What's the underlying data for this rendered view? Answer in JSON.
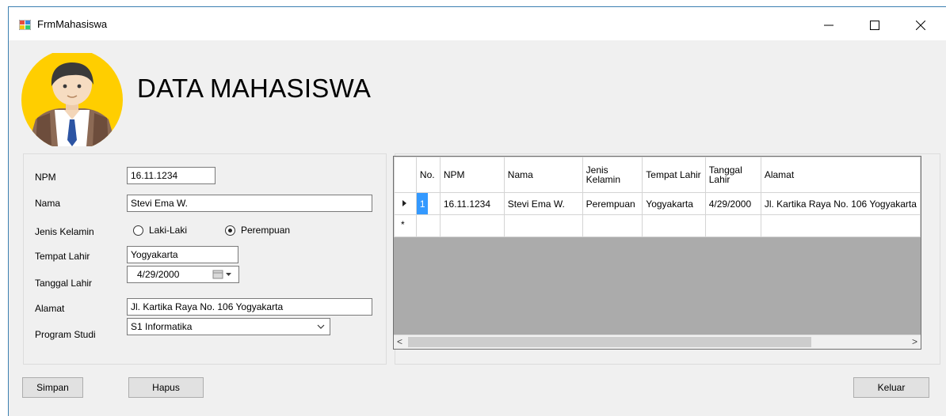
{
  "window": {
    "title": "FrmMahasiswa",
    "icon": "form-app-icon",
    "controls": {
      "minimize": "—",
      "maximize": "☐",
      "close": "✕"
    }
  },
  "header": {
    "title": "DATA MAHASISWA",
    "avatar_icon": "student-avatar-icon"
  },
  "form": {
    "npm": {
      "label": "NPM",
      "value": "16.11.1234"
    },
    "nama": {
      "label": "Nama",
      "value": "Stevi Ema W."
    },
    "jenis_kelamin": {
      "label": "Jenis Kelamin",
      "options": [
        "Laki-Laki",
        "Perempuan"
      ],
      "selected": "Perempuan"
    },
    "tempat_lahir": {
      "label": "Tempat Lahir",
      "value": "Yogyakarta"
    },
    "tanggal_lahir": {
      "label": "Tanggal Lahir",
      "value": "4/29/2000"
    },
    "alamat": {
      "label": "Alamat",
      "value": "Jl. Kartika Raya No. 106 Yogyakarta"
    },
    "program_studi": {
      "label": "Program Studi",
      "value": "S1 Informatika"
    }
  },
  "grid": {
    "columns": [
      "No.",
      "NPM",
      "Nama",
      "Jenis Kelamin",
      "Tempat Lahir",
      "Tanggal Lahir",
      "Alamat"
    ],
    "rows": [
      [
        "1",
        "16.11.1234",
        "Stevi Ema W.",
        "Perempuan",
        "Yogyakarta",
        "4/29/2000",
        "Jl. Kartika Raya No. 106 Yogyakarta"
      ]
    ],
    "new_row_marker": "*",
    "scroll_left": "<",
    "scroll_right": ">"
  },
  "buttons": {
    "simpan": "Simpan",
    "hapus": "Hapus",
    "keluar": "Keluar"
  },
  "colors": {
    "selection": "#3399ff",
    "grid_bg": "#ababab",
    "avatar_bg": "#ffce00"
  }
}
